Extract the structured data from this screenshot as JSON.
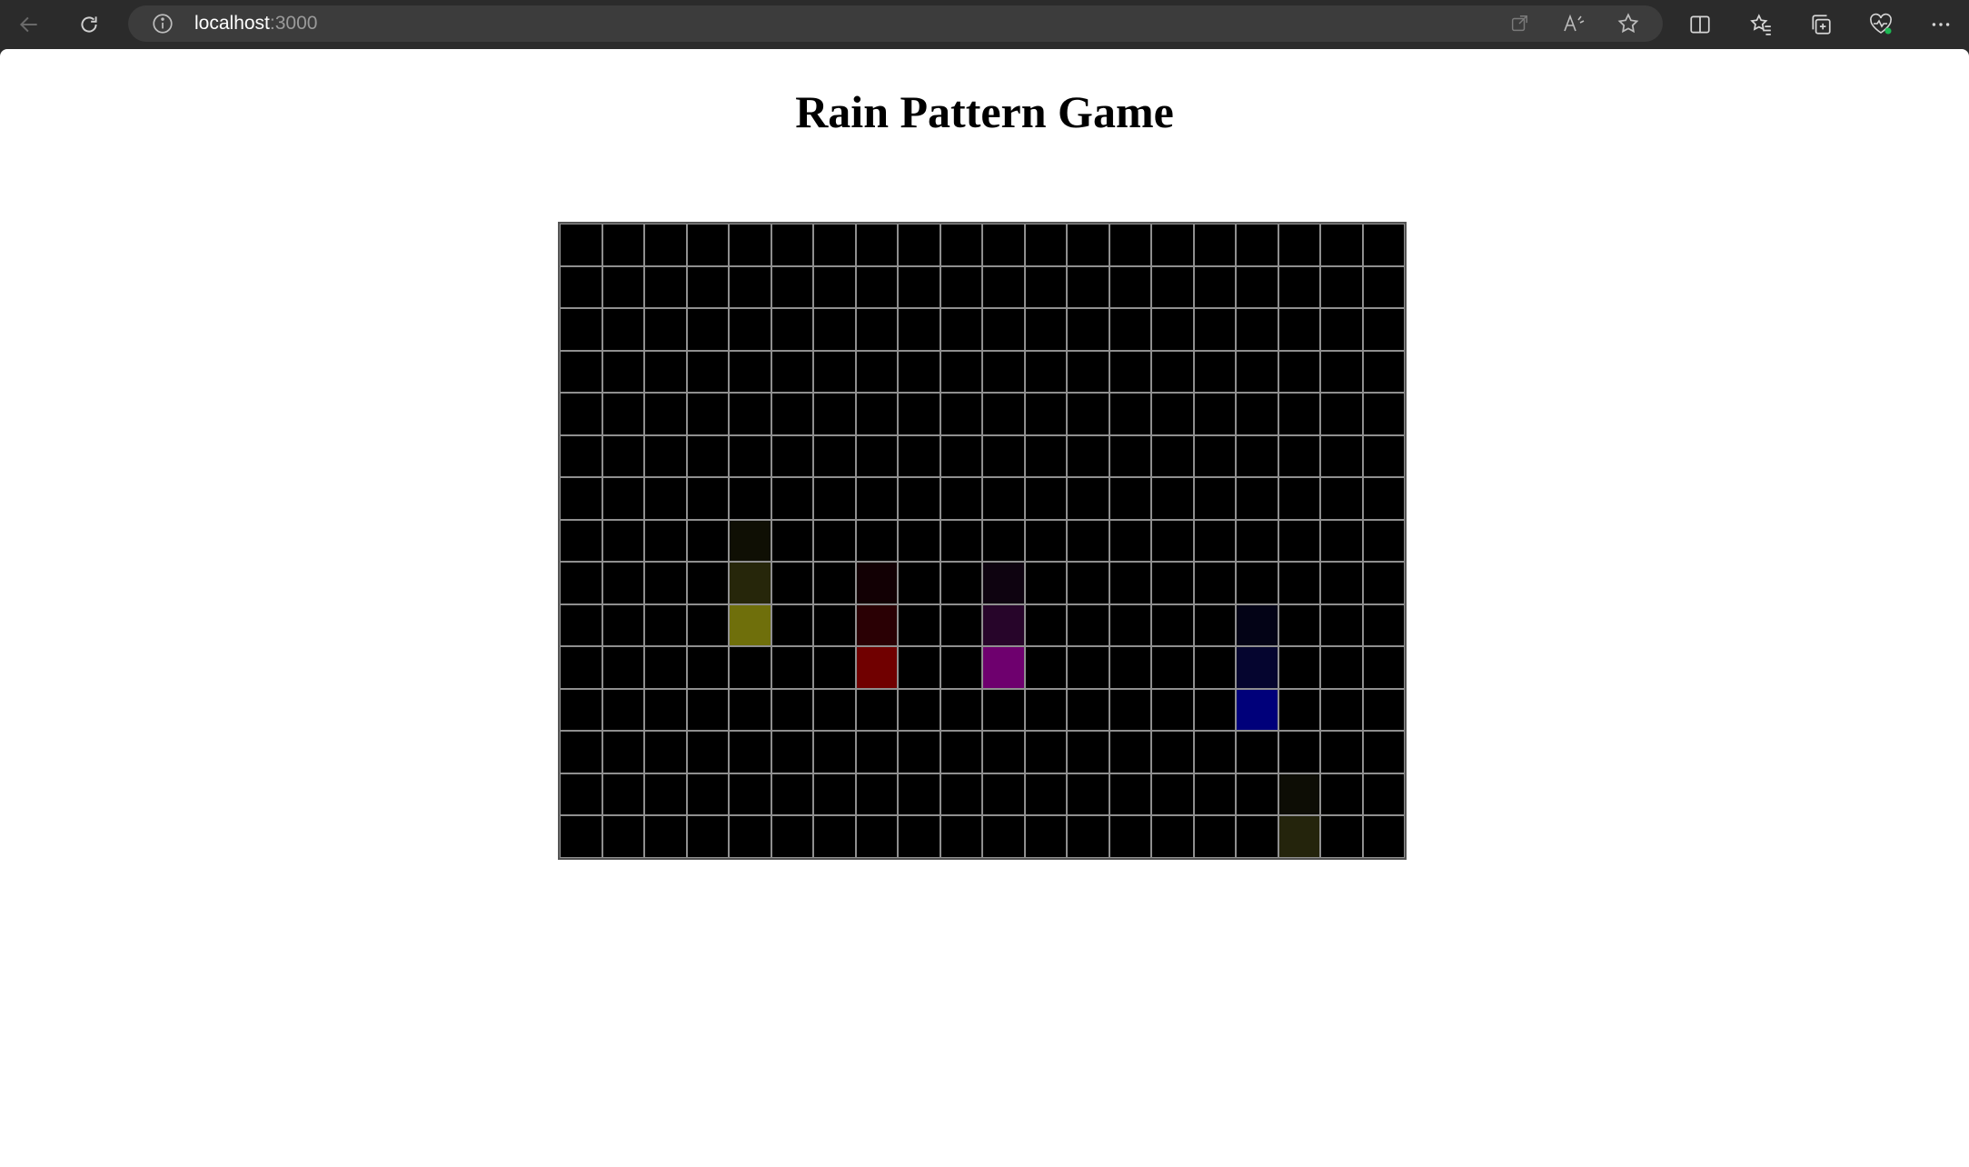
{
  "browser": {
    "url_host": "localhost",
    "url_port": ":3000",
    "icons": [
      "back-arrow-icon",
      "refresh-icon",
      "info-icon",
      "open-in-app-icon",
      "read-aloud-icon",
      "favorite-star-icon",
      "split-screen-icon",
      "favorites-icon",
      "collections-icon",
      "browser-essentials-icon",
      "more-icon"
    ]
  },
  "page": {
    "title": "Rain Pattern Game"
  },
  "game": {
    "columns": 20,
    "rows": 15,
    "cell_color": "#000000",
    "grid_line_color": "#8f8f8f",
    "lit_cells": [
      {
        "row": 7,
        "col": 4,
        "color": "#0f0f04"
      },
      {
        "row": 8,
        "col": 4,
        "color": "#26260a"
      },
      {
        "row": 9,
        "col": 4,
        "color": "#6f6f0b"
      },
      {
        "row": 8,
        "col": 7,
        "color": "#120004"
      },
      {
        "row": 9,
        "col": 7,
        "color": "#2a0004"
      },
      {
        "row": 10,
        "col": 7,
        "color": "#700000"
      },
      {
        "row": 8,
        "col": 10,
        "color": "#0e0310"
      },
      {
        "row": 9,
        "col": 10,
        "color": "#27052a"
      },
      {
        "row": 10,
        "col": 10,
        "color": "#6e006e"
      },
      {
        "row": 9,
        "col": 16,
        "color": "#030316"
      },
      {
        "row": 10,
        "col": 16,
        "color": "#05052f"
      },
      {
        "row": 11,
        "col": 16,
        "color": "#00007a"
      },
      {
        "row": 13,
        "col": 17,
        "color": "#0d0d05"
      },
      {
        "row": 14,
        "col": 17,
        "color": "#24240c"
      }
    ]
  }
}
